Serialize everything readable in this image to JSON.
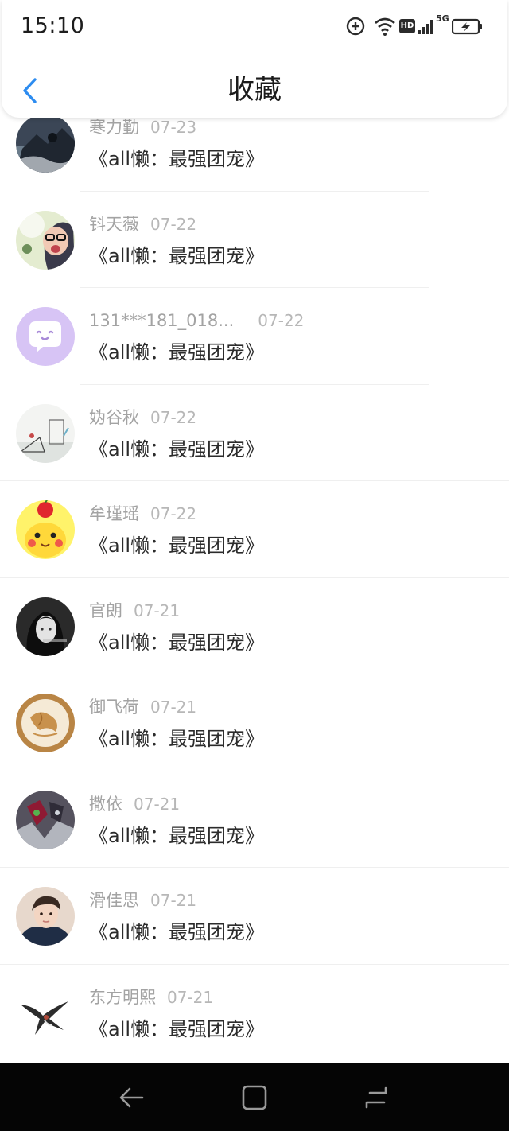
{
  "status_bar": {
    "time": "15:10",
    "network_badge": "HD",
    "network_type": "5G"
  },
  "header": {
    "title": "收藏"
  },
  "favorites": [
    {
      "user": "寒力勤",
      "date": "07-23",
      "title": "《all懒：最强团宠》",
      "avatar_icon": "dark-photo-avatar"
    },
    {
      "user": "钭天薇",
      "date": "07-22",
      "title": "《all懒：最强团宠》",
      "avatar_icon": "glasses-boy-avatar"
    },
    {
      "user": "131***181_018...",
      "date": "07-22",
      "title": "《all懒：最强团宠》",
      "avatar_icon": "purple-chat-bubble-avatar"
    },
    {
      "user": "妫谷秋",
      "date": "07-22",
      "title": "《all懒：最强团宠》",
      "avatar_icon": "sketch-avatar"
    },
    {
      "user": "牟瑾瑶",
      "date": "07-22",
      "title": "《all懒：最强团宠》",
      "avatar_icon": "pikachu-apple-avatar"
    },
    {
      "user": "官朗",
      "date": "07-21",
      "title": "《all懒：最强团宠》",
      "avatar_icon": "girl-portrait-avatar"
    },
    {
      "user": "御飞荷",
      "date": "07-21",
      "title": "《all懒：最强团宠》",
      "avatar_icon": "latte-art-avatar"
    },
    {
      "user": "撒依",
      "date": "07-21",
      "title": "《all懒：最强团宠》",
      "avatar_icon": "masked-rider-avatar"
    },
    {
      "user": "滑佳思",
      "date": "07-21",
      "title": "《all懒：最强团宠》",
      "avatar_icon": "boy-portrait-avatar"
    },
    {
      "user": "东方明熙",
      "date": "07-21",
      "title": "《all懒：最强团宠》",
      "avatar_icon": "swallow-bird-avatar"
    }
  ],
  "nav_bar": {
    "buttons": [
      "back-nav-icon",
      "home-nav-icon",
      "recents-nav-icon"
    ]
  },
  "colors": {
    "accent_blue": "#2d8cf0",
    "nav_bar": "#050505",
    "meta_text": "#a3a3a3",
    "title_text": "#2b2b2b",
    "purple_avatar": "#d7c4f5"
  }
}
